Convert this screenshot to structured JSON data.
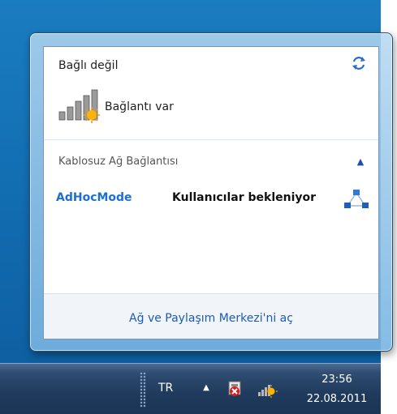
{
  "flyout": {
    "status_title": "Bağlı değil",
    "availability": "Bağlantı var",
    "section_title": "Kablosuz Ağ Bağlantısı",
    "network": {
      "name": "AdHocMode",
      "status": "Kullanıcılar bekleniyor"
    },
    "footer_link": "Ağ ve Paylaşım Merkezi'ni aç",
    "icons": {
      "refresh": "refresh-icon",
      "collapse": "chevron-up-icon",
      "signal": "wifi-signal-icon",
      "adhoc": "adhoc-network-icon"
    }
  },
  "taskbar": {
    "language": "TR",
    "time": "23:56",
    "date": "22.08.2011"
  },
  "colors": {
    "link": "#1a5bb8",
    "network_name": "#1c6fd0",
    "taskbar": "#1f3a5c"
  }
}
